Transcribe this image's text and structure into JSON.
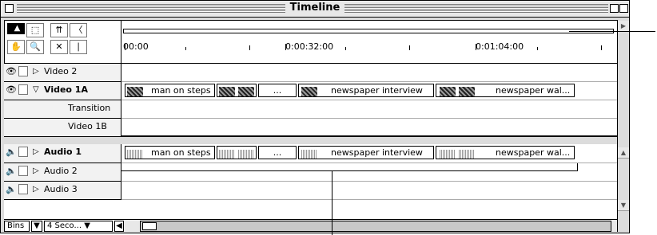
{
  "window": {
    "title": "Timeline"
  },
  "tools": [
    "selection-tool",
    "range-select-tool",
    "track-select-tool",
    "razor-tool",
    "hand-tool",
    "zoom-tool",
    "link-tool",
    "in-out-tool"
  ],
  "ruler": {
    "labels": [
      "00:00",
      "0:00:32:00",
      "0:01:04:00"
    ]
  },
  "tracks": {
    "video2": {
      "name": "Video 2"
    },
    "video1a": {
      "name": "Video 1A",
      "clips": [
        "man on steps",
        "...",
        "newspaper interview",
        "newspaper wal..."
      ]
    },
    "transition": {
      "name": "Transition"
    },
    "video1b": {
      "name": "Video 1B"
    },
    "audio1": {
      "name": "Audio 1",
      "clips": [
        "man on steps",
        "...",
        "newspaper interview",
        "newspaper wal..."
      ]
    },
    "audio2": {
      "name": "Audio 2"
    },
    "audio3": {
      "name": "Audio 3"
    }
  },
  "bottombar": {
    "bins_label": "Bins",
    "time_unit": "4 Seco..."
  }
}
